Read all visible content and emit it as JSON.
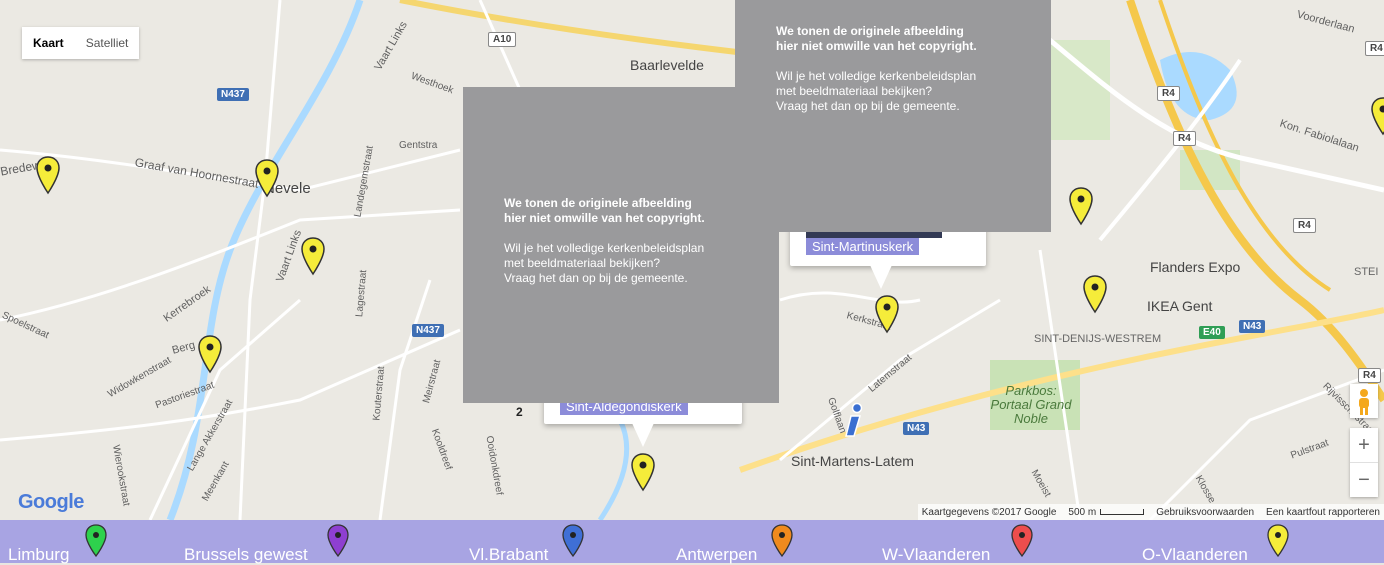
{
  "map": {
    "map_type": {
      "kaart": "Kaart",
      "satelliet": "Satelliet",
      "active": "Kaart"
    },
    "places": {
      "baarlevelde": "Baarlevelde",
      "nevele": "Nevele",
      "flanders_expo": "Flanders Expo",
      "ikea": "IKEA Gent",
      "sint_denijs": "SINT-DENIJS-WESTREM",
      "parkbos": "Parkbos: Portaal Grand Noble",
      "sint_martens": "Sint-Martens-Latem",
      "stet": "STEI"
    },
    "streets": {
      "bredeweg": "Bredeweg",
      "graaf": "Graaf van Hoornestraat",
      "gentstraat": "Gentstra",
      "westhoek": "Westhoek",
      "vaart_links_top": "Vaart Links",
      "vaart_links_mid": "Vaart Links",
      "landegemstraat": "Landegemstraat",
      "kerrebroek": "Kerrebroek",
      "spoelstraat": "Spoelstraat",
      "berg": "Berg",
      "lagestraat": "Lagestraat",
      "meirstraat": "Meirstraat",
      "kouterstraat": "Kouterstraat",
      "widowkenstraat": "Widowkenstraat",
      "pastoriestraat": "Pastoriestraat",
      "lange_akkerstraat": "Lange Akkerstraat",
      "kerkstraat": "Kerkstraat",
      "latemstraat": "Latemstraat",
      "golflaan": "Golflaan",
      "kon_fabiola": "Kon. Fabiolalaan",
      "pulstraat": "Pulstraat",
      "ringstraat": "Rijvisschestraat",
      "voordelaan": "Voorderlaan",
      "kooldreef": "Kooldreef",
      "ooidonk": "Ooidonkdreef",
      "meenkant": "Meenkant",
      "wierookstraat": "Wierookstraat",
      "klosse": "Klosse",
      "moeist": "Moeist"
    },
    "roads": {
      "a10": "A10",
      "n437_a": "N437",
      "n437_b": "N437",
      "r4_a": "R4",
      "r4_b": "R4",
      "r4_c": "R4",
      "r4_d": "R4",
      "r4_e": "R4",
      "e40": "E40",
      "n43_a": "N43",
      "n43_b": "N43"
    },
    "overlay": {
      "line1": "We tonen de originele afbeelding",
      "line2": "hier niet omwille van het copyright.",
      "line3": "Wil je het volledige kerkenbeleidsplan",
      "line4": "met beeldmateriaal bekijken?",
      "line5": "Vraag het dan op bij de gemeente."
    },
    "bubbles": {
      "aldegondis": "Sint-Aldegondiskerk",
      "martinus": "Sint-Martinuskerk"
    },
    "cluster_count": "2",
    "zoom": {
      "in": "+",
      "out": "−"
    },
    "logo": "Google",
    "footer": {
      "attribution": "Kaartgegevens ©2017 Google",
      "scale": "500 m",
      "terms": "Gebruiksvoorwaarden",
      "report": "Een kaartfout rapporteren"
    },
    "colors": {
      "pin_yellow": "#f5ec3a",
      "overlay_grey": "#9a9a9c",
      "bubble_tag": "#8c8cd9"
    }
  },
  "regions": {
    "items": [
      {
        "label": "Limburg",
        "color": "#2ed14d"
      },
      {
        "label": "Brussels gewest",
        "color": "#8e3fd1"
      },
      {
        "label": "Vl.Brabant",
        "color": "#3f6fd6"
      },
      {
        "label": "Antwerpen",
        "color": "#f08a1e"
      },
      {
        "label": "W-Vlaanderen",
        "color": "#ee4d4d"
      },
      {
        "label": "O-Vlaanderen",
        "color": "#f5ec3a"
      }
    ],
    "bar_color": "#a8a4e3"
  }
}
